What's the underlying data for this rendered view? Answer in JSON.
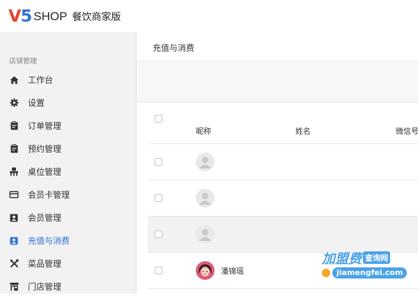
{
  "header": {
    "logo_v": "V",
    "logo_5": "5",
    "logo_shop": "SHOP",
    "logo_subtitle": "餐饮商家版"
  },
  "sidebar": {
    "section_title": "店铺管理",
    "items": [
      {
        "label": "工作台",
        "icon": "home-icon"
      },
      {
        "label": "设置",
        "icon": "gear-icon"
      },
      {
        "label": "订单管理",
        "icon": "clipboard-icon"
      },
      {
        "label": "预约管理",
        "icon": "clipboard-icon"
      },
      {
        "label": "桌位管理",
        "icon": "seat-icon"
      },
      {
        "label": "会员卡管理",
        "icon": "card-icon"
      },
      {
        "label": "会员管理",
        "icon": "contact-card-icon"
      },
      {
        "label": "充值与消费",
        "icon": "user-badge-icon",
        "active": true
      },
      {
        "label": "菜品管理",
        "icon": "utensils-icon"
      },
      {
        "label": "门店管理",
        "icon": "store-icon"
      }
    ],
    "active_color": "#2f73d8"
  },
  "main": {
    "title": "充值与消费",
    "table": {
      "headers": [
        "昵称",
        "姓名",
        "微信号"
      ],
      "rows": [
        {
          "nickname": "",
          "avatar": "default-avatar",
          "shaded": false
        },
        {
          "nickname": "",
          "avatar": "default-avatar",
          "shaded": false
        },
        {
          "nickname": "",
          "avatar": "default-avatar",
          "shaded": true
        },
        {
          "nickname": "潘锦瑶",
          "avatar": "photo-avatar",
          "shaded": false
        }
      ]
    }
  },
  "watermark": {
    "brand": "加盟费",
    "tag": "查询网",
    "url": "jiamengfei.com"
  }
}
